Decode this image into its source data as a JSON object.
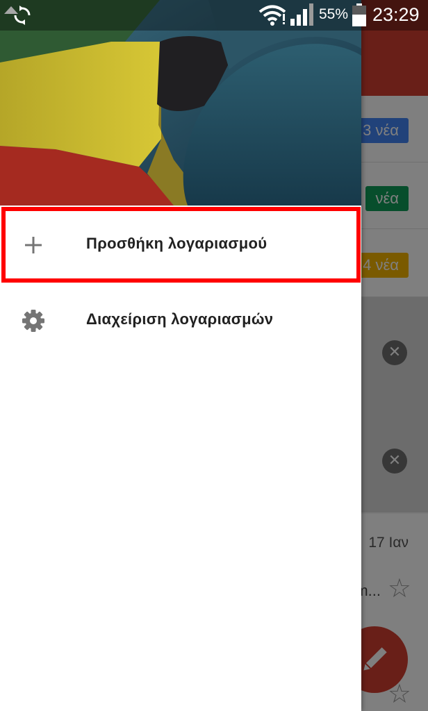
{
  "status_bar": {
    "battery_percent": "55%",
    "time": "23:29"
  },
  "drawer": {
    "items": [
      {
        "label": "Προσθήκη λογαριασμού",
        "icon": "plus-icon"
      },
      {
        "label": "Διαχείριση λογαριασμών",
        "icon": "gear-icon"
      }
    ]
  },
  "background": {
    "label_chips": [
      {
        "text": "3 νέα",
        "color": "#4285f4"
      },
      {
        "text": "νέα",
        "color": "#0f9d58"
      },
      {
        "text": "4 νέα",
        "color": "#f4b400"
      }
    ],
    "mail_date": "17 Ιαν",
    "mail_snippet": "m..."
  },
  "colors": {
    "highlight": "#ff0000",
    "gmail_red": "#d23f31"
  }
}
